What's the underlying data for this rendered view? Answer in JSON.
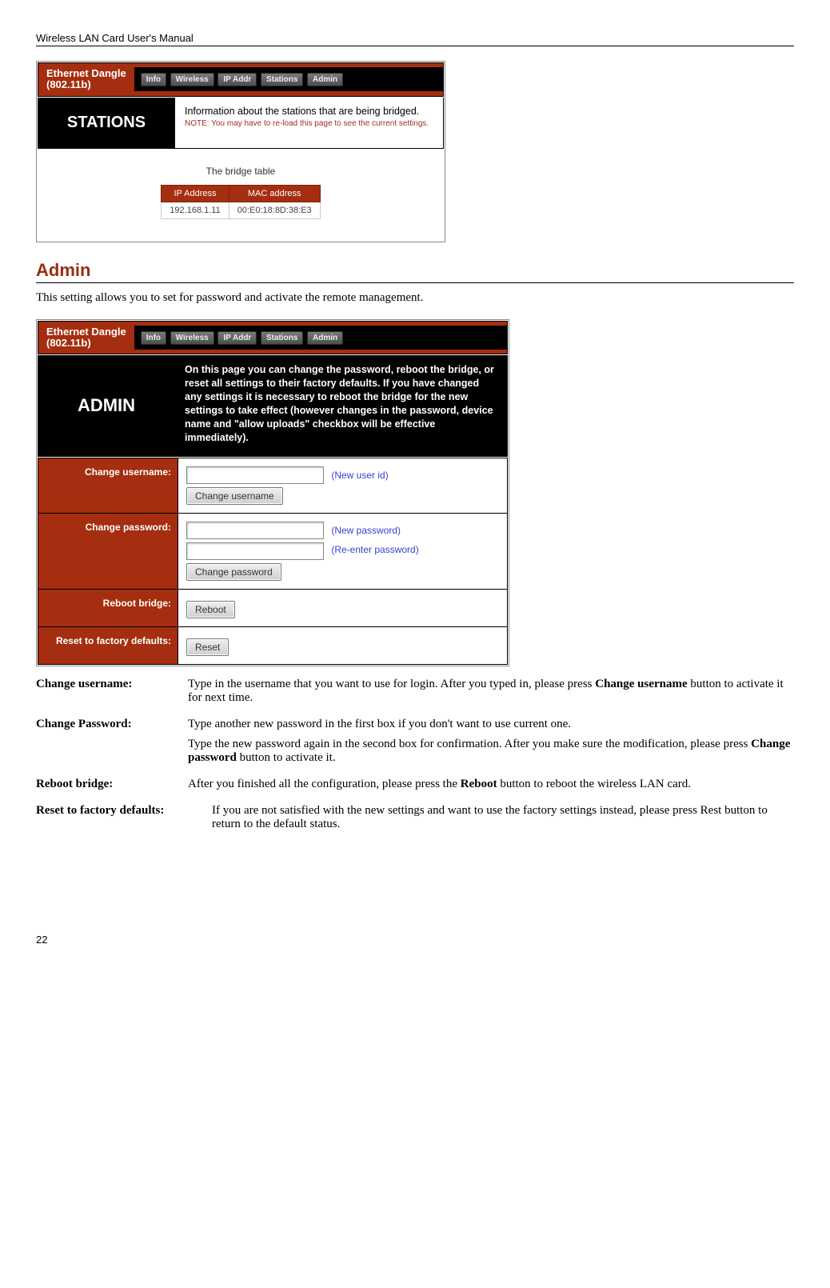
{
  "doc": {
    "header": "Wireless LAN Card User's Manual",
    "page_number": "22"
  },
  "stations_shot": {
    "device_title_line1": "Ethernet Dangle",
    "device_title_line2": "(802.11b)",
    "tabs": {
      "t1": "Info",
      "t2": "Wireless",
      "t3": "IP Addr",
      "t4": "Stations",
      "t5": "Admin"
    },
    "banner_label": "STATIONS",
    "banner_text": "Information about the stations that are being bridged.",
    "banner_note": "NOTE: You may have to re-load this page to see the current settings.",
    "table_caption": "The bridge table",
    "th_ip": "IP Address",
    "th_mac": "MAC address",
    "row_ip": "192.168.1.11",
    "row_mac": "00:E0:18:8D:38:E3"
  },
  "admin_section": {
    "title": "Admin",
    "intro": "This setting allows you to set for password and activate the remote management."
  },
  "admin_shot": {
    "device_title_line1": "Ethernet Dangle",
    "device_title_line2": "(802.11b)",
    "tabs": {
      "t1": "Info",
      "t2": "Wireless",
      "t3": "IP Addr",
      "t4": "Stations",
      "t5": "Admin"
    },
    "banner_label": "ADMIN",
    "banner_text": "On this page you can change the password, reboot the bridge, or reset all settings to their factory defaults. If you have changed any settings it is necessary to reboot the bridge for the new settings to take effect (however changes in the password, device name and \"allow uploads\" checkbox will be effective immediately).",
    "labels": {
      "change_username": "Change username:",
      "change_password": "Change password:",
      "reboot_bridge": "Reboot bridge:",
      "reset_defaults": "Reset to factory defaults:"
    },
    "hints": {
      "new_user": "(New user id)",
      "new_pass": "(New password)",
      "re_pass": "(Re-enter password)"
    },
    "buttons": {
      "change_username": "Change username",
      "change_password": "Change password",
      "reboot": "Reboot",
      "reset": "Reset"
    }
  },
  "definitions": {
    "change_username_term": "Change username:",
    "change_username_body1a": "Type in the username that you want to use for login. After you typed in, please press ",
    "change_username_body1b": "Change username",
    "change_username_body1c": " button to activate it for next time.",
    "change_password_term": "Change Password:",
    "change_password_body1": "Type another new password in the first box if you don't want to use current one.",
    "change_password_body2a": "Type the new password again in the second box for confirmation. After you make sure the modification, please press ",
    "change_password_body2b": "Change password",
    "change_password_body2c": " button to activate it.",
    "reboot_term": "Reboot bridge:",
    "reboot_body_a": "After you finished all the configuration, please press the ",
    "reboot_body_b": "Reboot",
    "reboot_body_c": " button to reboot the wireless LAN card.",
    "reset_term": "Reset to factory defaults:",
    "reset_body": "If you are not satisfied with the new settings and want to use the factory settings instead, please press Rest button to return to the default status."
  }
}
